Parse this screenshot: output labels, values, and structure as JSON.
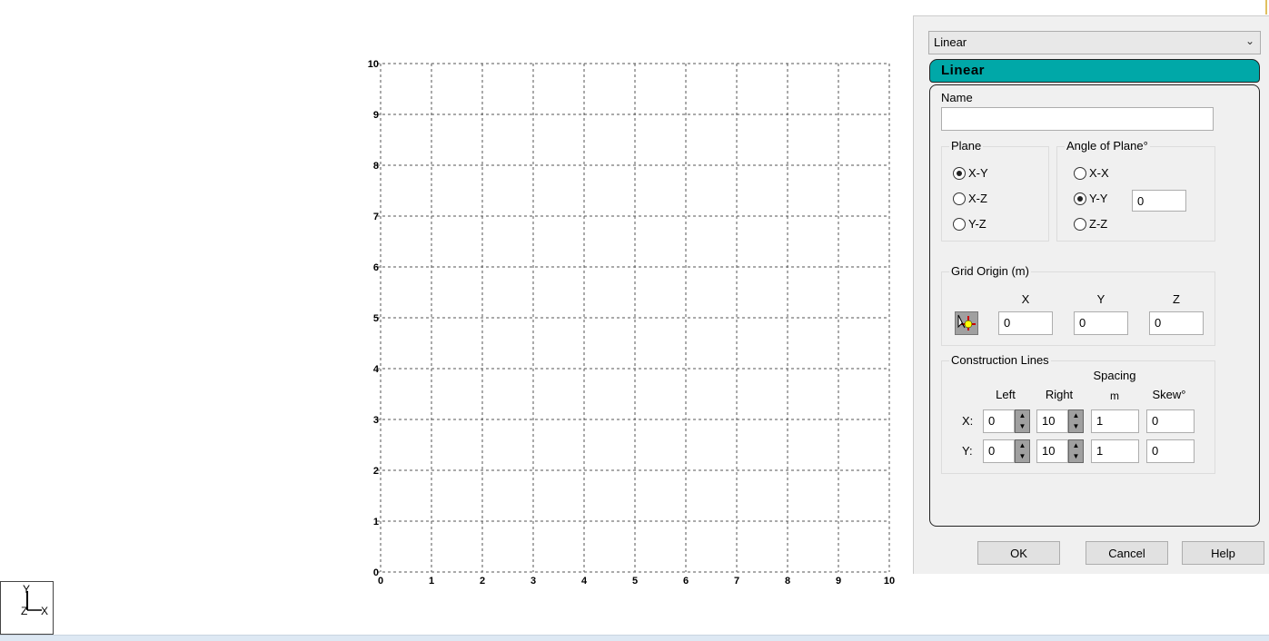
{
  "chart_data": {
    "type": "grid",
    "x_ticks": [
      0,
      1,
      2,
      3,
      4,
      5,
      6,
      7,
      8,
      9,
      10
    ],
    "y_ticks": [
      0,
      1,
      2,
      3,
      4,
      5,
      6,
      7,
      8,
      9,
      10
    ],
    "xlim": [
      0,
      10
    ],
    "ylim": [
      0,
      10
    ],
    "grid": true
  },
  "axis_indicator": {
    "y": "Y",
    "z": "Z",
    "x": "X"
  },
  "panel": {
    "type_select": "Linear",
    "header": "Linear",
    "name_label": "Name",
    "name_value": "",
    "plane": {
      "label": "Plane",
      "options": [
        "X-Y",
        "X-Z",
        "Y-Z"
      ],
      "selected": "X-Y"
    },
    "angle": {
      "label": "Angle of Plane°",
      "options": [
        "X-X",
        "Y-Y",
        "Z-Z"
      ],
      "selected": "Y-Y",
      "value": "0"
    },
    "origin": {
      "label": "Grid Origin (m)",
      "x_label": "X",
      "y_label": "Y",
      "z_label": "Z",
      "x": "0",
      "y": "0",
      "z": "0"
    },
    "construction": {
      "label": "Construction Lines",
      "spacing": "Spacing",
      "left": "Left",
      "right": "Right",
      "m": "m",
      "skew": "Skew°",
      "rows": [
        {
          "label": "X:",
          "left": "0",
          "right": "10",
          "spacing": "1",
          "skew": "0"
        },
        {
          "label": "Y:",
          "left": "0",
          "right": "10",
          "spacing": "1",
          "skew": "0"
        }
      ]
    },
    "ok": "OK",
    "cancel": "Cancel",
    "help": "Help"
  }
}
